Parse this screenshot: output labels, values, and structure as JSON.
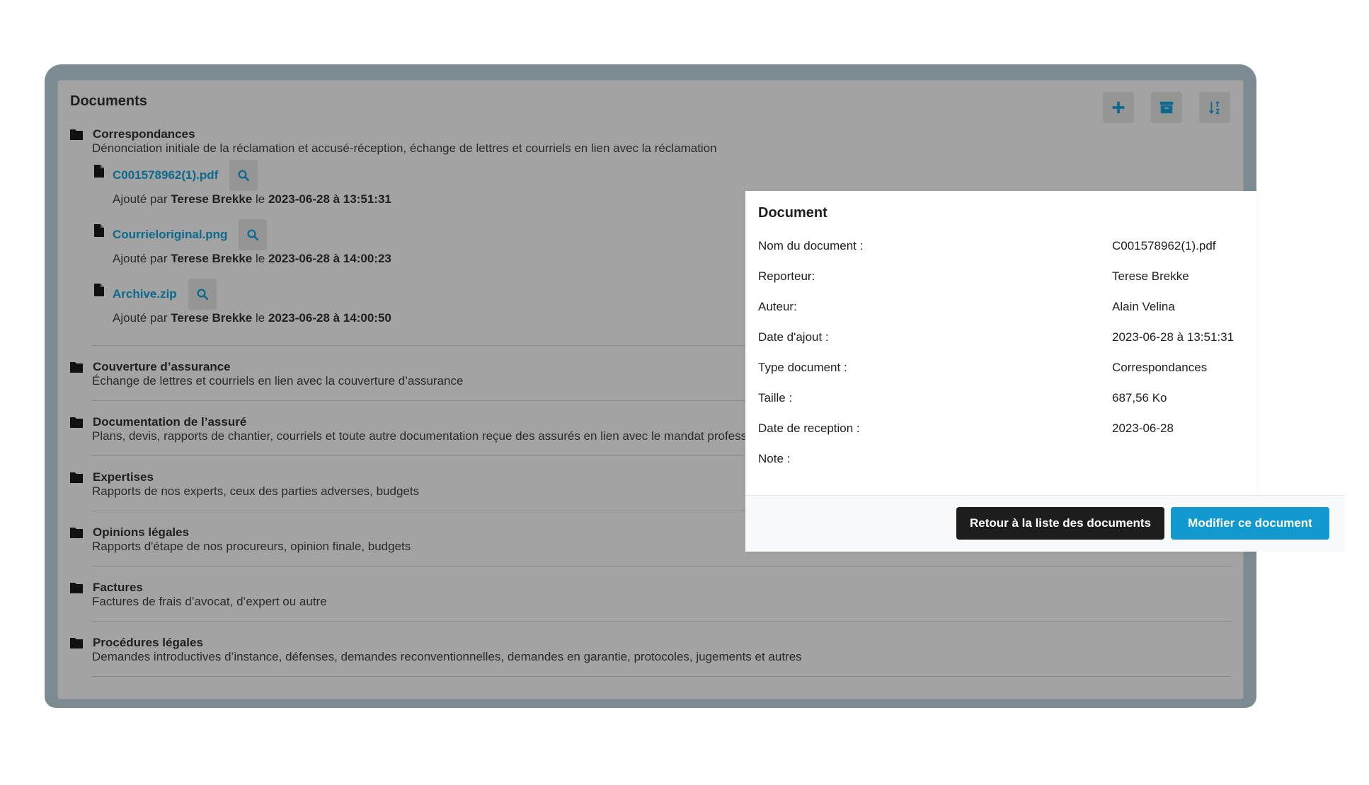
{
  "panel": {
    "title": "Documents",
    "toolbar": {
      "add_icon": "plus-icon",
      "archive_icon": "archive-icon",
      "sort_icon": "sort-icon"
    }
  },
  "categories": [
    {
      "name": "Correspondances",
      "description": "Dénonciation initiale de la réclamation et accusé-réception, échange de lettres et courriels en lien avec la réclamation",
      "files": [
        {
          "name": "C001578962(1).pdf",
          "added_prefix": "Ajouté par",
          "added_by": "Terese Brekke",
          "date_prefix": "le",
          "date": "2023-06-28 à 13:51:31"
        },
        {
          "name": "Courrieloriginal.png",
          "added_prefix": "Ajouté par",
          "added_by": "Terese Brekke",
          "date_prefix": "le",
          "date": "2023-06-28 à 14:00:23"
        },
        {
          "name": "Archive.zip",
          "added_prefix": "Ajouté par",
          "added_by": "Terese Brekke",
          "date_prefix": "le",
          "date": "2023-06-28 à 14:00:50"
        }
      ]
    },
    {
      "name": "Couverture d’assurance",
      "description": "Échange de lettres et courriels en lien avec la couverture d’assurance"
    },
    {
      "name": "Documentation de l’assuré",
      "description": "Plans, devis, rapports de chantier, courriels et toute autre documentation reçue des assurés en lien avec le mandat profess"
    },
    {
      "name": "Expertises",
      "description": "Rapports de nos experts, ceux des parties adverses, budgets"
    },
    {
      "name": "Opinions légales",
      "description": "Rapports d'étape de nos procureurs, opinion finale, budgets"
    },
    {
      "name": "Factures",
      "description": "Factures de frais d’avocat, d’expert ou autre"
    },
    {
      "name": "Procédures légales",
      "description": "Demandes introductives d’instance, défenses, demandes reconventionnelles, demandes en garantie, protocoles, jugements et autres"
    }
  ],
  "modal": {
    "title": "Document",
    "fields": [
      {
        "label": "Nom du document :",
        "value": "C001578962(1).pdf"
      },
      {
        "label": "Reporteur:",
        "value": "Terese Brekke"
      },
      {
        "label": "Auteur:",
        "value": "Alain Velina"
      },
      {
        "label": "Date d'ajout :",
        "value": "2023-06-28 à 13:51:31"
      },
      {
        "label": "Type document :",
        "value": "Correspondances"
      },
      {
        "label": "Taille :",
        "value": "687,56 Ko"
      },
      {
        "label": "Date de reception :",
        "value": "2023-06-28"
      },
      {
        "label": "Note :",
        "value": ""
      }
    ],
    "back_button": "Retour à la liste des documents",
    "edit_button": "Modifier ce document"
  },
  "colors": {
    "overlay_frame": "#7c8a92",
    "panel_bg": "#a3a3a3",
    "link": "#0b6a8e",
    "icon_accent": "#0b6a8e",
    "primary_button": "#1199d0",
    "dark_button": "#1d1d1d"
  }
}
